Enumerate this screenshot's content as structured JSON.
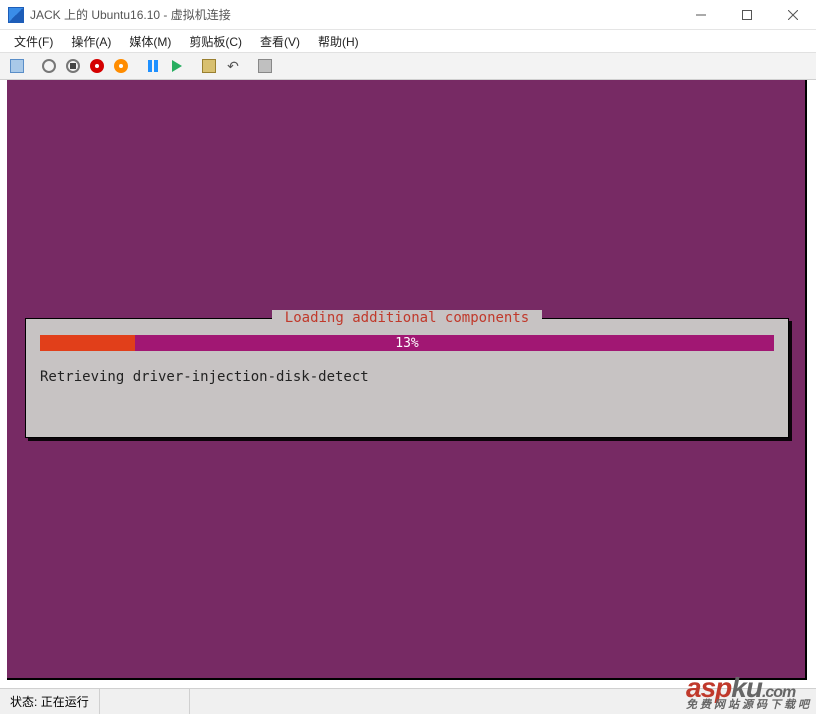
{
  "titlebar": {
    "title": "JACK 上的 Ubuntu16.10 - 虚拟机连接"
  },
  "menubar": {
    "items": [
      "文件(F)",
      "操作(A)",
      "媒体(M)",
      "剪贴板(C)",
      "查看(V)",
      "帮助(H)"
    ]
  },
  "toolbar": {
    "buttons": [
      "ctrl-alt-del",
      "start",
      "stop",
      "shutdown",
      "reset",
      "pause",
      "resume",
      "checkpoint",
      "revert",
      "enhanced-session"
    ]
  },
  "vm": {
    "dialog": {
      "title": " Loading additional components ",
      "progress_percent": 13,
      "progress_label": "13%",
      "status_text": "Retrieving driver-injection-disk-detect"
    },
    "background_color": "#772a64"
  },
  "statusbar": {
    "label": "状态:",
    "value": "正在运行"
  },
  "watermark": {
    "brand1": "asp",
    "brand2": "ku",
    "domain": ".com",
    "tag": "免费网站源码下载吧"
  }
}
